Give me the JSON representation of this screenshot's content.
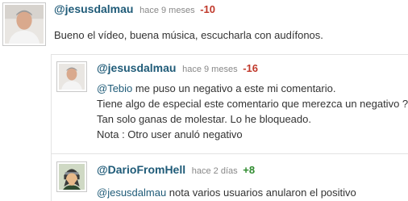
{
  "comments": [
    {
      "user": "@jesusdalmau",
      "time": "hace 9 meses",
      "score": "-10",
      "lines": [
        "Bueno el vídeo, buena música, escucharla con audífonos."
      ]
    },
    {
      "user": "@jesusdalmau",
      "time": "hace 9 meses",
      "score": "-16",
      "mention": "@Tebio",
      "lines": [
        " me puso un negativo a este mi comentario.",
        "Tiene algo de especial este comentario que merezca un negativo ?",
        "Tan solo ganas de molestar. Lo he bloqueado.",
        "Nota : Otro user anuló negativo"
      ]
    },
    {
      "user": "@DarioFromHell",
      "time": "hace 2 días",
      "score": "+8",
      "mention": "@jesusdalmau",
      "lines": [
        " nota varios usuarios anularon el positivo"
      ]
    }
  ],
  "colors": {
    "username": "#1f5b78",
    "negative": "#c0392b",
    "positive": "#2e8b2e"
  },
  "icons": [
    "avatar-photo-icon",
    "avatar-photo-icon",
    "avatar-cartoon-icon"
  ]
}
